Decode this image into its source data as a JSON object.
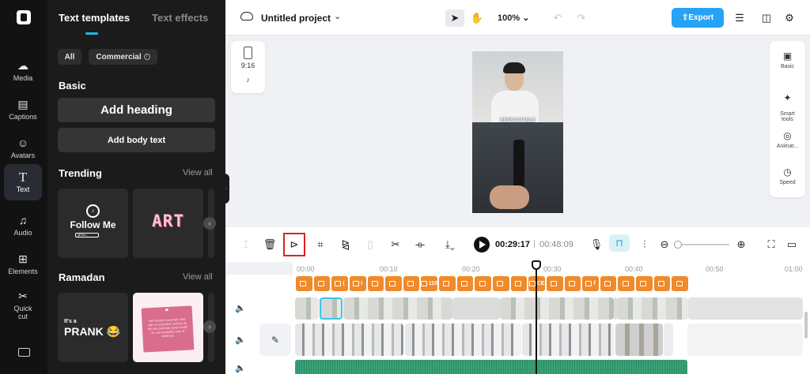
{
  "sidebar": {
    "items": [
      {
        "label": "Media",
        "icon": "cloud-upload-icon"
      },
      {
        "label": "Captions",
        "icon": "captions-icon"
      },
      {
        "label": "Avatars",
        "icon": "avatar-icon"
      },
      {
        "label": "Text",
        "icon": "text-icon",
        "active": true
      },
      {
        "label": "Audio",
        "icon": "music-icon"
      },
      {
        "label": "Elements",
        "icon": "elements-icon"
      },
      {
        "label": "Quick\ncut",
        "icon": "quick-cut-icon"
      }
    ]
  },
  "panel": {
    "tabs": [
      "Text templates",
      "Text effects"
    ],
    "filters": [
      "All",
      "Commercial"
    ],
    "basic_heading": "Basic",
    "add_heading": "Add heading",
    "add_body": "Add body text",
    "trending_heading": "Trending",
    "ramadan_heading": "Ramadan",
    "view_all": "View all",
    "trending_cards": [
      {
        "title": "Follow Me",
        "sub": "@Tim..."
      },
      {
        "title": "ART"
      }
    ],
    "ramadan_cards": [
      {
        "its": "It's a",
        "title": "PRANK 😂"
      },
      {
        "quote": "We should remember that salt as a positive outlook on life can promote good health as can everyday acts of kindness."
      }
    ]
  },
  "topbar": {
    "project_title": "Untitled project",
    "zoom": "100%",
    "export_label": "Export"
  },
  "canvas": {
    "ratio": "9:16",
    "caption": "RETRACTABLE"
  },
  "right_tools": [
    {
      "label": "Basic",
      "icon": "basic-icon"
    },
    {
      "label": "Smart\ntools",
      "icon": "magic-wand-icon"
    },
    {
      "label": "Animat...",
      "icon": "animation-icon"
    },
    {
      "label": "Speed",
      "icon": "speed-icon"
    }
  ],
  "timeline": {
    "current_time": "00:29:17",
    "separator": "|",
    "total_time": "00:48:09",
    "ruler": [
      "00:00",
      "00:10",
      "00:20",
      "00:30",
      "00:40",
      "00:50",
      "01:00"
    ],
    "text_clips": [
      "",
      "",
      "(",
      "i",
      "",
      "",
      "",
      "110",
      "",
      "",
      "",
      "",
      "",
      "CE",
      "",
      "",
      "f",
      "",
      "",
      "",
      "",
      ""
    ]
  }
}
